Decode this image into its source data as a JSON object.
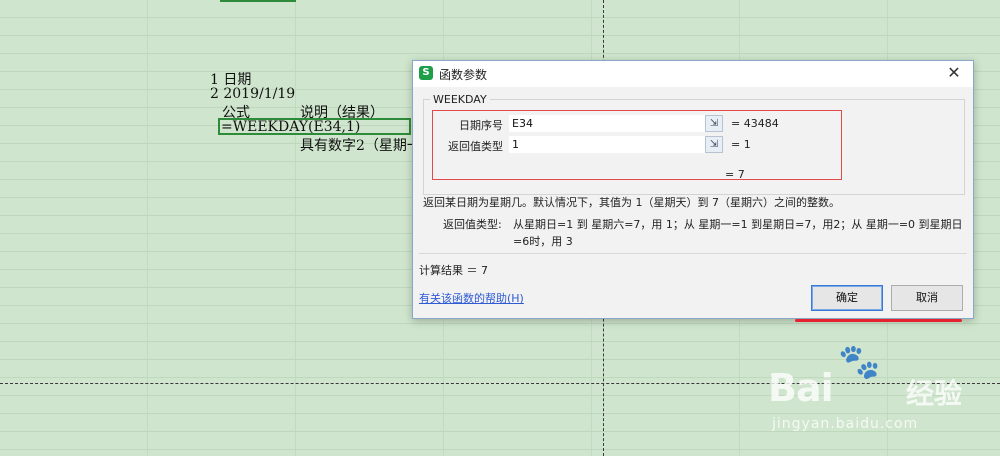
{
  "sheet": {
    "cells": {
      "row1": "1 日期",
      "row2": "2  2019/1/19",
      "header_formula": "公式",
      "header_desc": "说明（结果）",
      "formula": "=WEEKDAY(E34,1)",
      "desc_partial": "具有数字2（星期一"
    }
  },
  "dialog": {
    "title": "函数参数",
    "app_icon_letter": "S",
    "close_glyph": "✕",
    "function_name": "WEEKDAY",
    "args": [
      {
        "label": "日期序号",
        "value": "E34",
        "result": "= 43484"
      },
      {
        "label": "返回值类型",
        "value": "1",
        "result": "= 1"
      }
    ],
    "formula_result": "= 7",
    "description": "返回某日期为星期几。默认情况下，其值为 1（星期天）到 7（星期六）之间的整数。",
    "arg_help_label": "返回值类型:",
    "arg_help_text": "从星期日=1 到 星期六=7，用 1；从 星期一=1 到星期日=7，用2；从 星期一=0 到星期日=6时，用 3",
    "calc_result": "计算结果 ＝ 7",
    "help_link": "有关该函数的帮助(H)",
    "ok_label": "确定",
    "cancel_label": "取消",
    "ref_icon": "⇲"
  },
  "watermark": {
    "paw": "🐾",
    "brand": "Bai",
    "brand_cn": "经验",
    "url": "jingyan.baidu.com"
  },
  "colors": {
    "sheet_bg": "#cfe5cd",
    "active_border": "#2e8b3a",
    "annotation_red": "#e04a4a",
    "link_blue": "#2f5bd4"
  }
}
